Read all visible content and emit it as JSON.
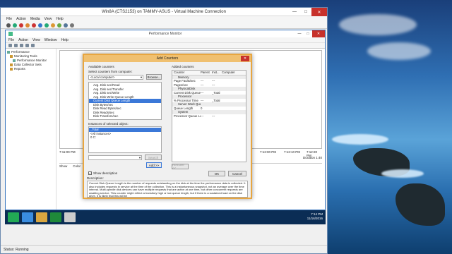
{
  "vm": {
    "title": "Win8A (CTS2153) on TAMMY-ASUS - Virtual Machine Connection",
    "menu": [
      "File",
      "Action",
      "Media",
      "View",
      "Help"
    ],
    "status": "Status: Running"
  },
  "perfmon": {
    "title": "Performance Monitor",
    "menu": [
      "File",
      "Action",
      "View",
      "Window",
      "Help"
    ],
    "tree": [
      "Performance",
      "Monitoring Tools",
      "Performance Monitor",
      "Data Collector Sets",
      "Reports"
    ],
    "times": [
      "7:11:00 PM",
      "7:11:30 PM",
      "7:12:00 PM",
      "7:12:10 PM",
      "7:12:20 PM"
    ],
    "stats": {
      "minimum_label": "Minimum",
      "duration_label": "Duration",
      "duration_value": "1:40"
    },
    "legend": [
      "Show",
      "Color"
    ]
  },
  "dialog": {
    "title": "Add Counters",
    "available_label": "Available counters",
    "select_from_label": "Select counters from computer:",
    "computer_value": "<Local computer>",
    "browse_label": "Browse...",
    "counters": [
      "Avg. Disk sec/Read",
      "Avg. Disk sec/Transfer",
      "Avg. Disk sec/Write",
      "Avg. Disk Write Queue Length",
      "Current Disk Queue Length",
      "Disk Bytes/sec",
      "Disk Read Bytes/sec",
      "Disk Reads/sec",
      "Disk Transfers/sec"
    ],
    "selected_counter_index": 4,
    "instances_label": "Instances of selected object:",
    "instances": [
      "_Total",
      "<All instances>",
      "0 C:"
    ],
    "selected_instance_index": 0,
    "search_label": "Search",
    "add_label": "Add >>",
    "added_label": "Added counters",
    "added_columns": [
      "Counter",
      "Parent",
      "Inst...",
      "Computer"
    ],
    "added_rows": [
      {
        "kind": "cat",
        "c": "Memory",
        "p": "",
        "i": "",
        "m": ""
      },
      {
        "kind": "row",
        "c": "Page Faults/sec",
        "p": "---",
        "i": "---",
        "m": ""
      },
      {
        "kind": "row",
        "c": "Pages/sec",
        "p": "---",
        "i": "---",
        "m": ""
      },
      {
        "kind": "cat",
        "c": "PhysicalDisk",
        "p": "",
        "i": "",
        "m": ""
      },
      {
        "kind": "row",
        "c": "Current Disk Queue ...",
        "p": "---",
        "i": "_Total",
        "m": ""
      },
      {
        "kind": "cat",
        "c": "Processor",
        "p": "",
        "i": "",
        "m": ""
      },
      {
        "kind": "row",
        "c": "% Processor Time",
        "p": "---",
        "i": "_Total",
        "m": ""
      },
      {
        "kind": "cat",
        "c": "Server Work Queues",
        "p": "",
        "i": "",
        "m": ""
      },
      {
        "kind": "row",
        "c": "Queue Length",
        "p": "0",
        "i": "",
        "m": ""
      },
      {
        "kind": "cat",
        "c": "System",
        "p": "",
        "i": "",
        "m": ""
      },
      {
        "kind": "row",
        "c": "Processor Queue Le...",
        "p": "---",
        "i": "---",
        "m": ""
      }
    ],
    "remove_label": "Remove <<",
    "show_description_label": "Show description",
    "ok_label": "OK",
    "cancel_label": "Cancel",
    "description_label": "Description:",
    "description_text": "Current Disk Queue Length is the number of requests outstanding on the disk at the time the performance data is collected. It also includes requests in service at the time of the collection. This is a instantaneous snapshot, not an average over the time interval. Multi-spindle disk devices can have multiple requests that are active at one time, but other concurrent requests are awaiting service. This counter might reflect a transitory high or low queue length, but if there is a sustained load on the disk drive, it is likely that this will be"
  },
  "taskbar": {
    "time": "7:14 PM",
    "date": "11/16/2016"
  }
}
